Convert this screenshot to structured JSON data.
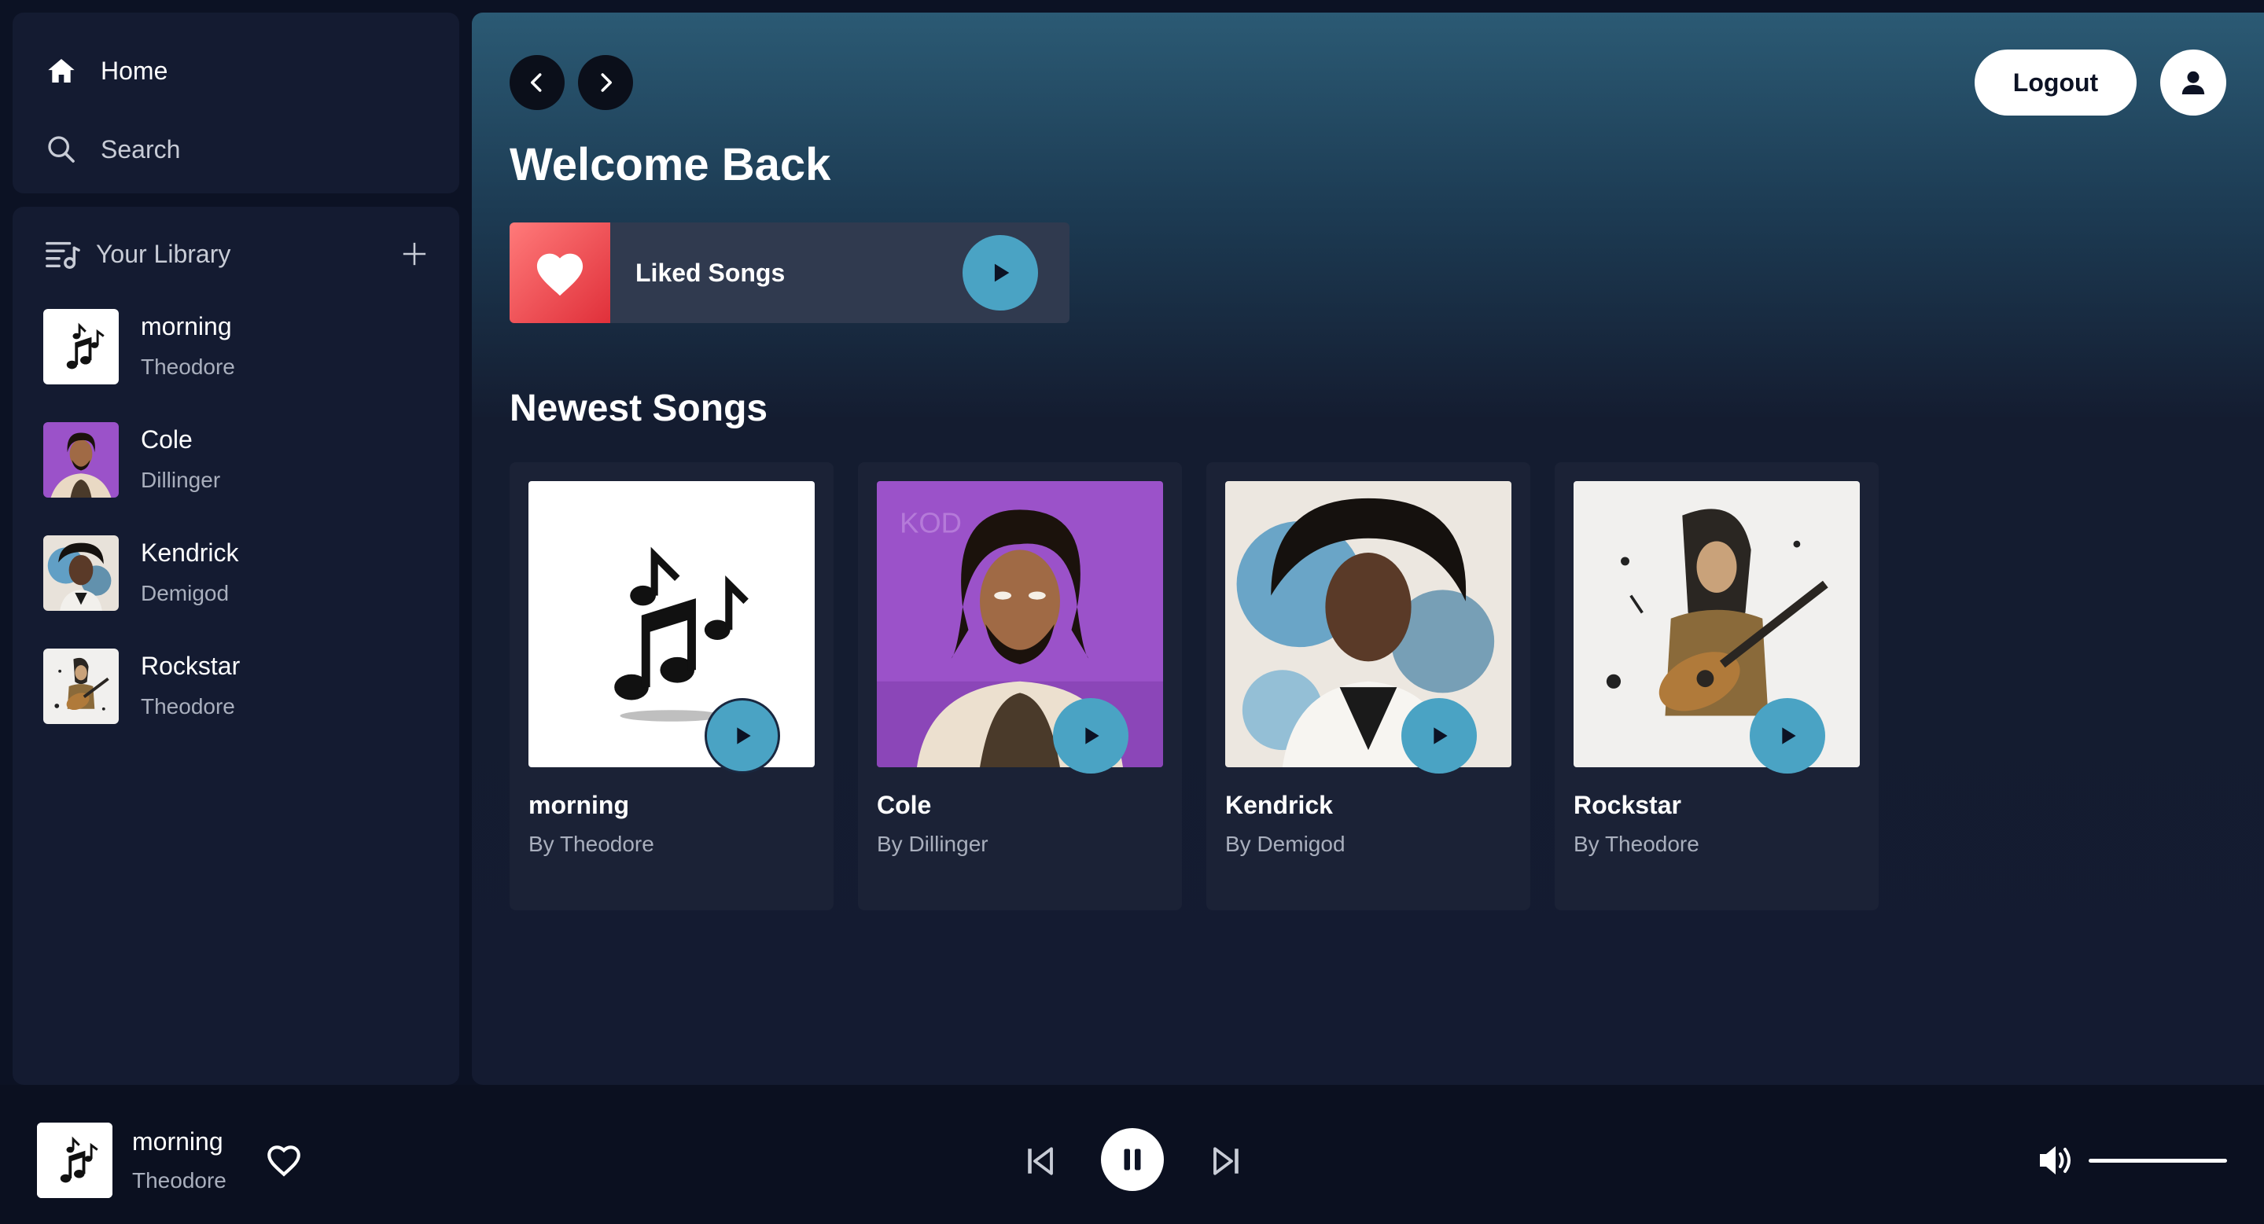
{
  "nav": {
    "home_label": "Home",
    "search_label": "Search"
  },
  "library": {
    "title": "Your Library",
    "items": [
      {
        "title": "morning",
        "artist": "Theodore",
        "cover": "music-notes-art"
      },
      {
        "title": "Cole",
        "artist": "Dillinger",
        "cover": "cole-portrait-art"
      },
      {
        "title": "Kendrick",
        "artist": "Demigod",
        "cover": "kendrick-portrait-art"
      },
      {
        "title": "Rockstar",
        "artist": "Theodore",
        "cover": "rockstar-guitar-art"
      }
    ]
  },
  "header": {
    "logout_label": "Logout"
  },
  "main": {
    "welcome": "Welcome Back",
    "liked_songs_label": "Liked Songs",
    "newest_title": "Newest Songs",
    "cards": [
      {
        "title": "morning",
        "artist": "By Theodore"
      },
      {
        "title": "Cole",
        "artist": "By Dillinger"
      },
      {
        "title": "Kendrick",
        "artist": "By Demigod"
      },
      {
        "title": "Rockstar",
        "artist": "By Theodore"
      }
    ]
  },
  "player": {
    "title": "morning",
    "artist": "Theodore",
    "state": "playing",
    "volume": 1.0
  },
  "colors": {
    "accent": "#4aa3c4",
    "panel": "#141b31",
    "liked_gradient_start": "#ff7a7a",
    "liked_gradient_end": "#e0303a"
  }
}
